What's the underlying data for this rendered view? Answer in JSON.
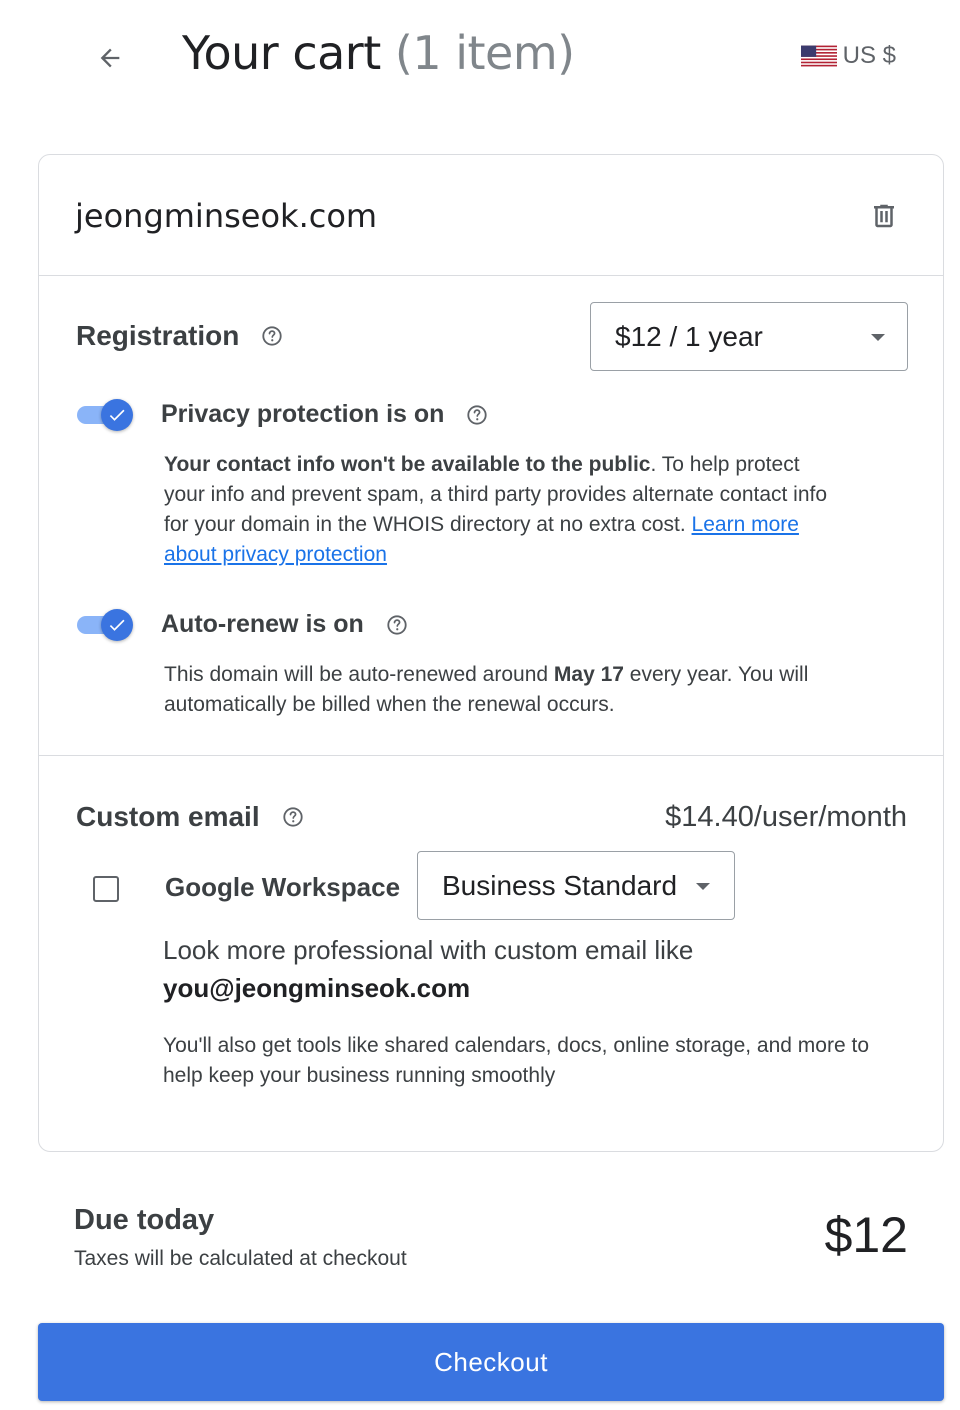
{
  "header": {
    "title": "Your cart",
    "item_count": "(1 item)",
    "currency": "US $",
    "back_icon": "arrow-back-icon",
    "flag_icon": "us-flag-icon"
  },
  "cart_item": {
    "domain": "jeongminseok.com",
    "delete_icon": "trash-icon",
    "registration": {
      "label": "Registration",
      "selected_term": "$12 / 1 year"
    },
    "privacy": {
      "label": "Privacy protection is on",
      "enabled": true,
      "desc_bold": "Your contact info won't be available to the public",
      "desc_text": ". To help protect your info and prevent spam, a third party provides alternate contact info for your domain in the WHOIS directory at no extra cost. ",
      "link": "Learn more about privacy protection"
    },
    "auto_renew": {
      "label": "Auto-renew is on",
      "enabled": true,
      "desc_before": "This domain will be auto-renewed around ",
      "desc_date": "May 17",
      "desc_after": " every year. You will automatically be billed when the renewal occurs."
    }
  },
  "custom_email": {
    "label": "Custom email",
    "price": "$14.40/user/month",
    "product": "Google Workspace",
    "checked": false,
    "selected_plan": "Business Standard",
    "pitch": "Look more professional with custom email like",
    "example_address": "you@jeongminseok.com",
    "tools": "You'll also get tools like shared calendars, docs, online storage, and more to help keep your business running smoothly"
  },
  "summary": {
    "due_label": "Due today",
    "tax_note": "Taxes will be calculated at checkout",
    "amount": "$12"
  },
  "checkout_label": "Checkout",
  "colors": {
    "accent": "#3a74e0",
    "toggle_track": "#8ab4f8",
    "link": "#1a73e8",
    "border": "#dadce0"
  }
}
